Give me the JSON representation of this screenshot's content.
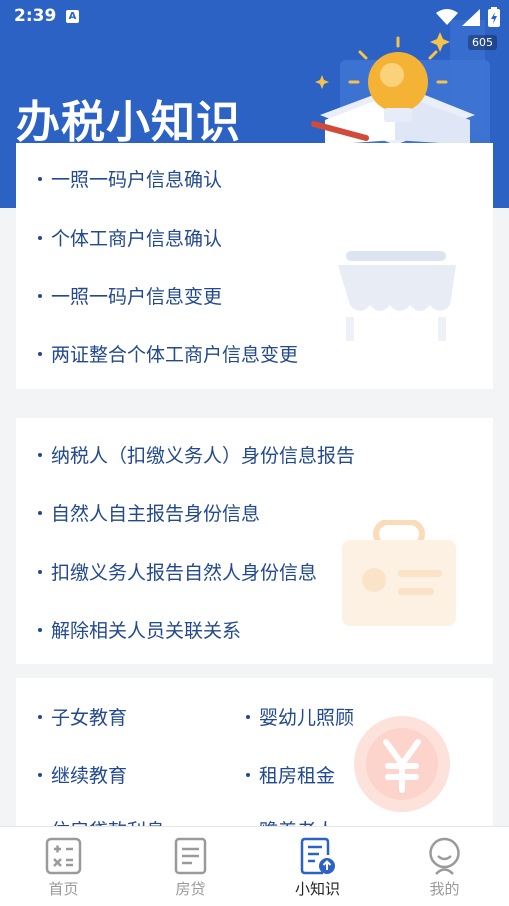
{
  "status_bar": {
    "time": "2:39",
    "app_badge": "A",
    "corner_badge": "605"
  },
  "header": {
    "title": "办税小知识"
  },
  "cards": [
    {
      "items": [
        "一照一码户信息确认",
        "个体工商户信息确认",
        "一照一码户信息变更",
        "两证整合个体工商户信息变更"
      ]
    },
    {
      "items": [
        "纳税人（扣缴义务人）身份信息报告",
        "自然人自主报告身份信息",
        "扣缴义务人报告自然人身份信息",
        "解除相关人员关联关系"
      ]
    },
    {
      "items": [
        "子女教育",
        "婴幼儿照顾",
        "继续教育",
        "租房租金",
        "住房贷款利息",
        "赡养老人"
      ]
    }
  ],
  "tabbar": {
    "tabs": [
      {
        "label": "首页",
        "icon": "calculator-icon"
      },
      {
        "label": "房贷",
        "icon": "document-icon"
      },
      {
        "label": "小知识",
        "icon": "knowledge-upload-icon"
      },
      {
        "label": "我的",
        "icon": "user-icon"
      }
    ],
    "active": "小知识"
  },
  "colors": {
    "header_blue": "#2b62c4",
    "item_text": "#23498f",
    "active_icon": "#2b62c4",
    "inactive": "#9a9a9a"
  }
}
